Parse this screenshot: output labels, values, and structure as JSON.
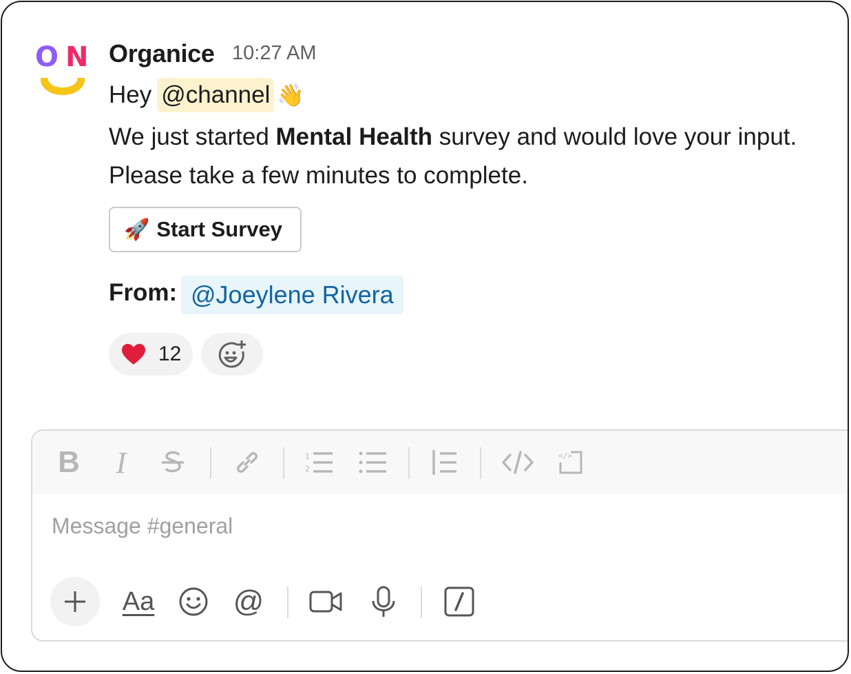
{
  "message": {
    "sender": "Organice",
    "time": "10:27 AM",
    "greeting": "Hey",
    "channel_mention": "@channel",
    "wave_emoji": "👋",
    "body_part1": "We just started ",
    "body_bold": "Mental Health",
    "body_part2": " survey and would love your input. Please take a few minutes to complete.",
    "avatar": {
      "letter_o": "O",
      "letter_n": "N"
    },
    "button": {
      "emoji": "🚀",
      "label": "Start Survey"
    },
    "from_label": "From:",
    "from_user": "@Joeylene Rivera",
    "reactions": [
      {
        "icon": "heart-icon",
        "count": "12"
      }
    ]
  },
  "composer": {
    "placeholder": "Message #general",
    "toolbar_bold": "B",
    "toolbar_italic": "I",
    "format_button": "Aa",
    "mention_button": "@"
  },
  "colors": {
    "avatar_o": "#8f5cf5",
    "avatar_n": "#f0296b",
    "avatar_smile": "#f5c518",
    "channel_highlight": "#fcf3ce",
    "user_mention_bg": "#e8f5fa",
    "user_mention_text": "#1264a3",
    "heart": "#e01e3c"
  }
}
